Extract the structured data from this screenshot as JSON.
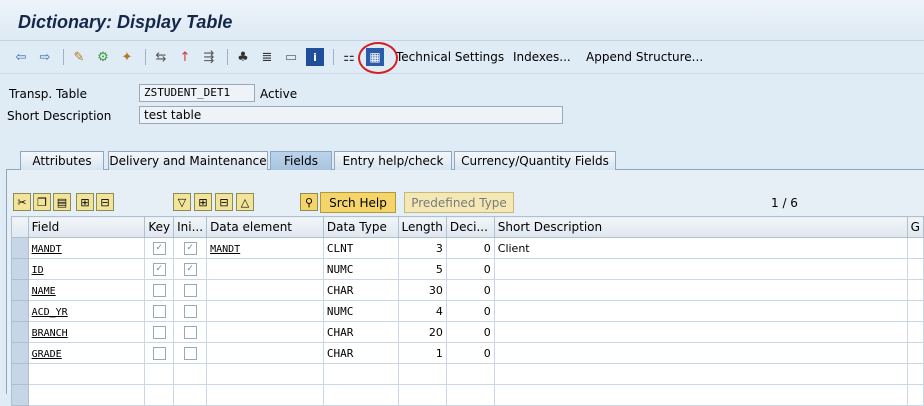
{
  "window": {
    "title": "Dictionary: Display Table"
  },
  "toolbar": {
    "technical_settings": "Technical Settings",
    "indexes": "Indexes...",
    "append_structure": "Append Structure..."
  },
  "header": {
    "transp_table_label": "Transp. Table",
    "table_name": "ZSTUDENT_DET1",
    "status": "Active",
    "short_desc_label": "Short Description",
    "short_desc_value": "test table"
  },
  "tabs": [
    "Attributes",
    "Delivery and Maintenance",
    "Fields",
    "Entry help/check",
    "Currency/Quantity Fields"
  ],
  "active_tab": "Fields",
  "table_toolbar": {
    "srch_help": "Srch Help",
    "predefined_type": "Predefined Type",
    "page_indicator": "1 / 6"
  },
  "columns": [
    "Field",
    "Key",
    "Ini...",
    "Data element",
    "Data Type",
    "Length",
    "Deci...",
    "Short Description",
    "G"
  ],
  "rows": [
    {
      "field": "MANDT",
      "key": true,
      "init": true,
      "data_element": "MANDT",
      "data_type": "CLNT",
      "length": "3",
      "decimals": "0",
      "short_desc": "Client"
    },
    {
      "field": "ID",
      "key": true,
      "init": true,
      "data_element": "",
      "data_type": "NUMC",
      "length": "5",
      "decimals": "0",
      "short_desc": ""
    },
    {
      "field": "NAME",
      "key": false,
      "init": false,
      "data_element": "",
      "data_type": "CHAR",
      "length": "30",
      "decimals": "0",
      "short_desc": ""
    },
    {
      "field": "ACD_YR",
      "key": false,
      "init": false,
      "data_element": "",
      "data_type": "NUMC",
      "length": "4",
      "decimals": "0",
      "short_desc": ""
    },
    {
      "field": "BRANCH",
      "key": false,
      "init": false,
      "data_element": "",
      "data_type": "CHAR",
      "length": "20",
      "decimals": "0",
      "short_desc": ""
    },
    {
      "field": "GRADE",
      "key": false,
      "init": false,
      "data_element": "",
      "data_type": "CHAR",
      "length": "1",
      "decimals": "0",
      "short_desc": ""
    }
  ],
  "colors": {
    "background": "#dfebf5",
    "title": "#14284b",
    "highlight": "#d42020",
    "button_yellow": "#f5d56a"
  }
}
